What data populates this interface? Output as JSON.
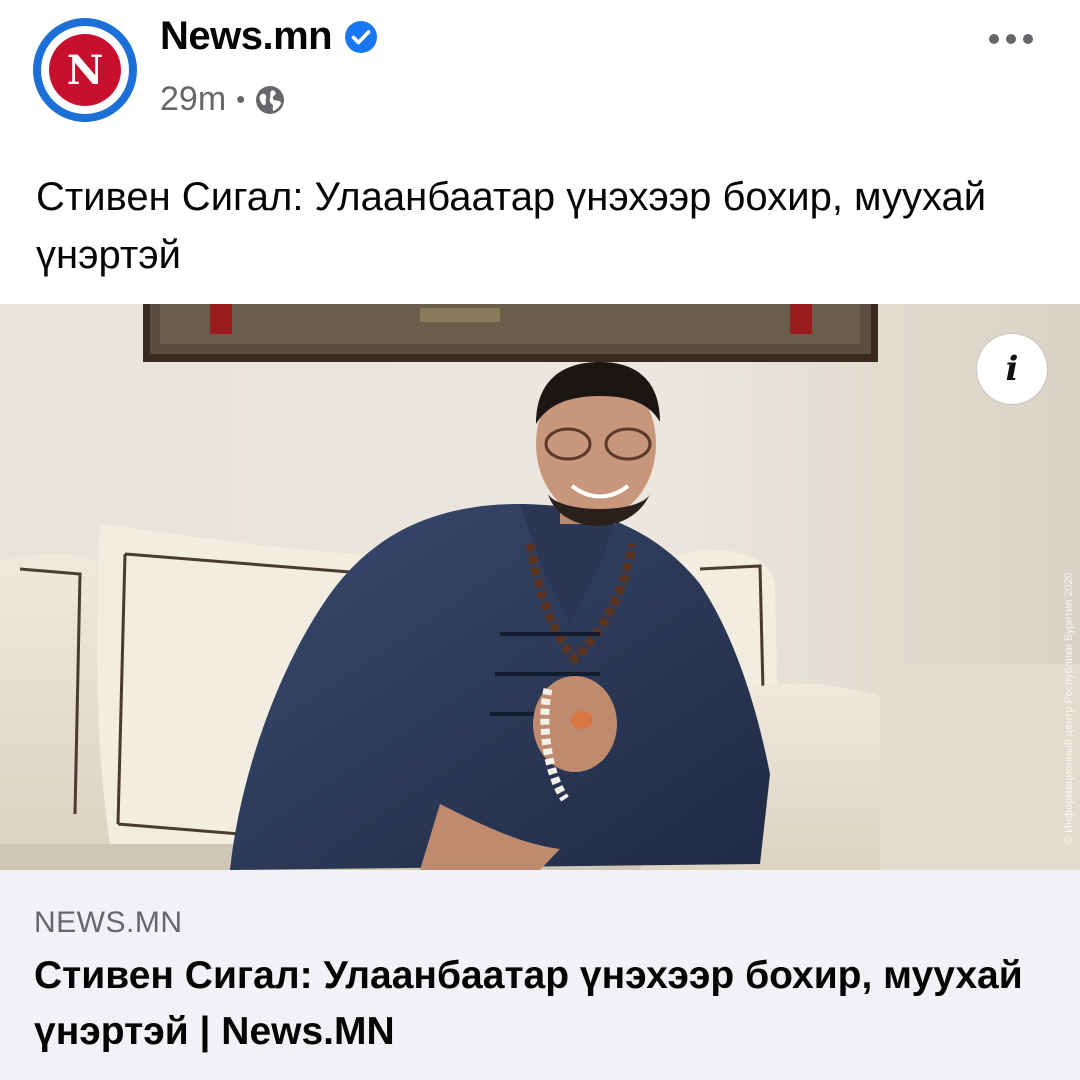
{
  "post": {
    "page_name": "News.mn",
    "time": "29m",
    "separator": "•",
    "avatar_letter": "N",
    "headline": "Стивен Сигал: Улаанбаатар үнэхээр бохир, муухай үнэртэй",
    "info_label": "i"
  },
  "link_preview": {
    "domain": "NEWS.MN",
    "title": "Стивен Сигал: Улаанбаатар үнэхээр бохир, муухай үнэртэй | News.MN"
  },
  "icons": {
    "verified": "verified-badge-icon",
    "audience": "globe-icon",
    "more": "more-options-icon",
    "info": "info-icon"
  },
  "colors": {
    "brand_red": "#c8102e",
    "brand_blue": "#1b6fd6",
    "verified_blue": "#1877f2",
    "secondary_text": "#65676b",
    "link_box_bg": "#f0f2f5"
  }
}
